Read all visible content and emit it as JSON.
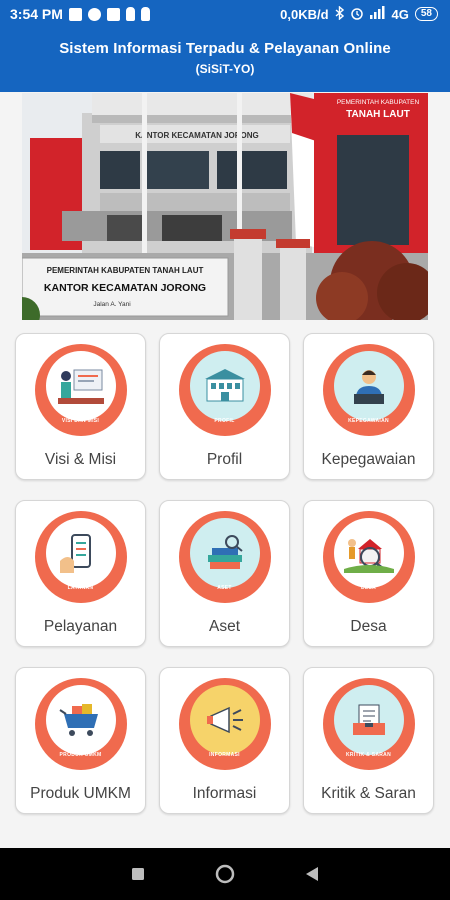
{
  "status_bar": {
    "time": "3:54 PM",
    "network_speed": "0,0KB/d",
    "signal": "4G",
    "battery": "58"
  },
  "header": {
    "title": "Sistem Informasi Terpadu & Pelayanan Online",
    "subtitle": "(SiSiT-YO)"
  },
  "banner": {
    "roof_sign": "KANTOR KECAMATAN JORONG",
    "right_sign_line1": "PEMERINTAH KABUPATEN",
    "right_sign_line2": "TANAH LAUT",
    "gate_line1": "PEMERINTAH KABUPATEN TANAH LAUT",
    "gate_line2": "KANTOR KECAMATAN JORONG",
    "gate_line3": "Jalan A. Yani"
  },
  "menu": [
    {
      "label": "Visi & Misi",
      "badge": "VISI DAN MISI",
      "icon": "presentation-icon"
    },
    {
      "label": "Profil",
      "badge": "PROFIL",
      "icon": "building-icon"
    },
    {
      "label": "Kepegawaian",
      "badge": "KEPEGAWAIAN",
      "icon": "employee-icon"
    },
    {
      "label": "Pelayanan",
      "badge": "LAYANAN",
      "icon": "phone-checklist-icon"
    },
    {
      "label": "Aset",
      "badge": "ASET",
      "icon": "asset-icon"
    },
    {
      "label": "Desa",
      "badge": "DESA",
      "icon": "village-icon"
    },
    {
      "label": "Produk UMKM",
      "badge": "PRODUK UMKM",
      "icon": "cart-icon"
    },
    {
      "label": "Informasi",
      "badge": "INFORMASI",
      "icon": "megaphone-icon"
    },
    {
      "label": "Kritik & Saran",
      "badge": "KRITIK & SARAN",
      "icon": "feedback-icon"
    }
  ],
  "colors": {
    "primary": "#1565c0",
    "circle": "#f06a4e",
    "building_red": "#d2232a"
  }
}
